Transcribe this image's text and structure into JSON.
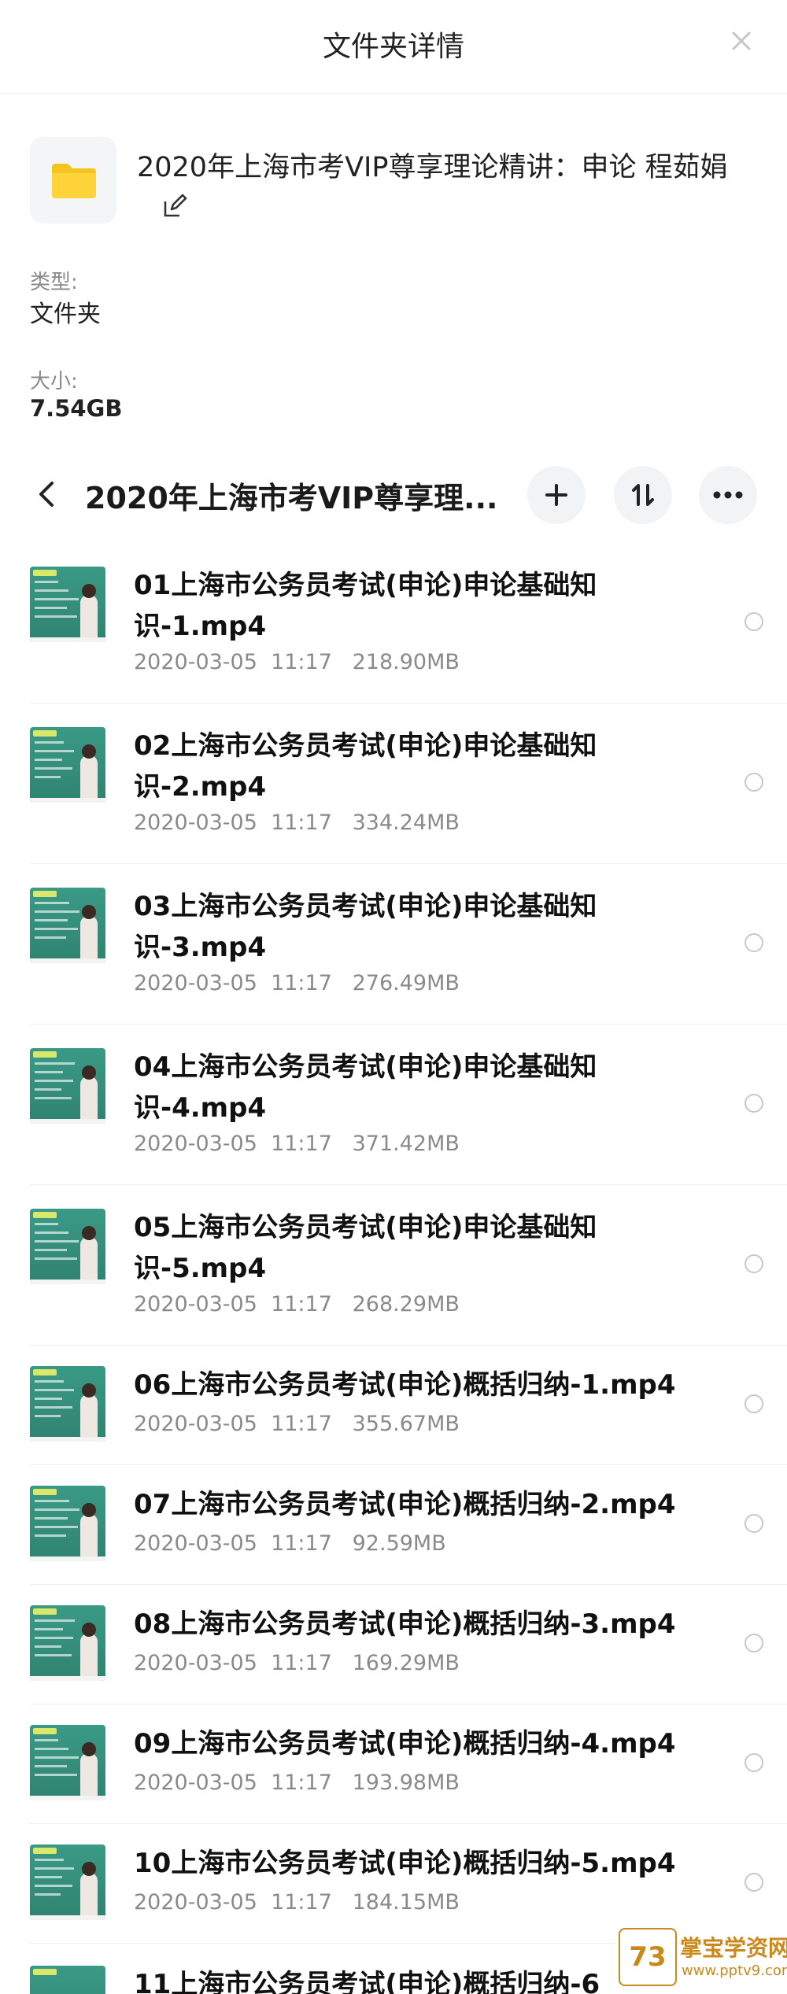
{
  "header": {
    "title": "文件夹详情"
  },
  "folder": {
    "name": "2020年上海市考VIP尊享理论精讲：申论 程茹娟",
    "type_label": "类型:",
    "type_value": "文件夹",
    "size_label": "大小:",
    "size_value": "7.54GB"
  },
  "nav": {
    "title": "2020年上海市考VIP尊享理..."
  },
  "files": [
    {
      "name": "01上海市公务员考试(申论)申论基础知识-1.mp4",
      "meta": "2020-03-05  11:17   218.90MB"
    },
    {
      "name": "02上海市公务员考试(申论)申论基础知识-2.mp4",
      "meta": "2020-03-05  11:17   334.24MB"
    },
    {
      "name": "03上海市公务员考试(申论)申论基础知识-3.mp4",
      "meta": "2020-03-05  11:17   276.49MB"
    },
    {
      "name": "04上海市公务员考试(申论)申论基础知识-4.mp4",
      "meta": "2020-03-05  11:17   371.42MB"
    },
    {
      "name": "05上海市公务员考试(申论)申论基础知识-5.mp4",
      "meta": "2020-03-05  11:17   268.29MB"
    },
    {
      "name": "06上海市公务员考试(申论)概括归纳-1.mp4",
      "meta": "2020-03-05  11:17   355.67MB"
    },
    {
      "name": "07上海市公务员考试(申论)概括归纳-2.mp4",
      "meta": "2020-03-05  11:17   92.59MB"
    },
    {
      "name": "08上海市公务员考试(申论)概括归纳-3.mp4",
      "meta": "2020-03-05  11:17   169.29MB"
    },
    {
      "name": "09上海市公务员考试(申论)概括归纳-4.mp4",
      "meta": "2020-03-05  11:17   193.98MB"
    },
    {
      "name": "10上海市公务员考试(申论)概括归纳-5.mp4",
      "meta": "2020-03-05  11:17   184.15MB"
    }
  ],
  "partial_file": {
    "name": "11上海市公务员考试(申论)概括归纳-6"
  },
  "watermark": {
    "logo": "73",
    "text": "掌宝学资网",
    "url": "www.pptv9.com"
  },
  "colors": {
    "thumb_green": "#3a9a86",
    "watermark_gold": "#c98a1b",
    "secondary_text": "#8a8a8a"
  }
}
